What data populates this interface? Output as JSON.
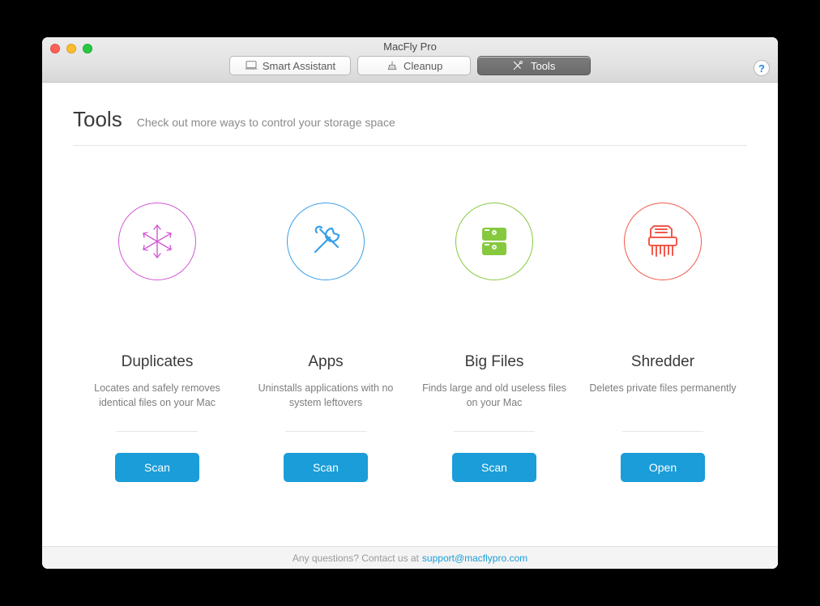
{
  "window": {
    "title": "MacFly Pro"
  },
  "tabs": {
    "smart_assistant": "Smart Assistant",
    "cleanup": "Cleanup",
    "tools": "Tools",
    "selected": "tools"
  },
  "help_label": "?",
  "page": {
    "title": "Tools",
    "subtitle": "Check out more ways to control your storage space"
  },
  "cards": [
    {
      "id": "duplicates",
      "title": "Duplicates",
      "desc": "Locates and safely removes identical files on your Mac",
      "button": "Scan",
      "circle_color": "#d257d4",
      "icon": "snowflake"
    },
    {
      "id": "apps",
      "title": "Apps",
      "desc": "Uninstalls applications with no system leftovers",
      "button": "Scan",
      "circle_color": "#39a0e8",
      "icon": "wrench"
    },
    {
      "id": "bigfiles",
      "title": "Big Files",
      "desc": "Finds large and old useless files on your Mac",
      "button": "Scan",
      "circle_color": "#86c93f",
      "icon": "drawer"
    },
    {
      "id": "shredder",
      "title": "Shredder",
      "desc": "Deletes private files permanently",
      "button": "Open",
      "circle_color": "#f2594b",
      "icon": "shredder"
    }
  ],
  "footer": {
    "text": "Any questions? Contact us at ",
    "link_label": "support@macflypro.com",
    "link_href": "mailto:support@macflypro.com"
  },
  "colors": {
    "accent_button": "#1a9dd9"
  }
}
